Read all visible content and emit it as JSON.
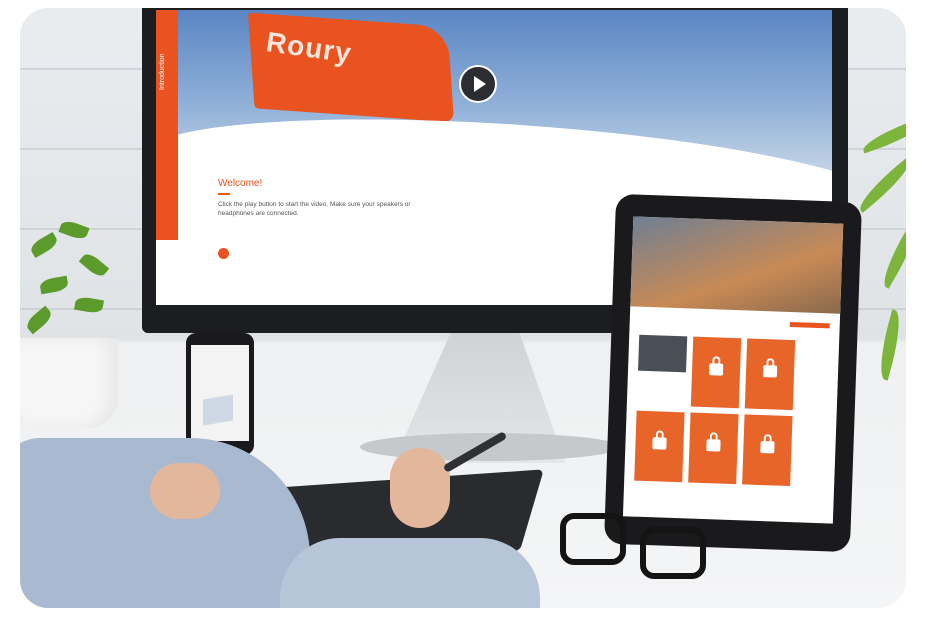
{
  "monitor": {
    "sidebar_label": "Introduction",
    "flag_text": "Roury",
    "welcome_title": "Welcome!",
    "welcome_body": "Click the play button to start the video. Make sure your speakers or headphones are connected."
  },
  "colors": {
    "accent": "#e8531f",
    "tile": "#e8652a"
  },
  "icons": [
    "play-icon",
    "lock-icon"
  ]
}
